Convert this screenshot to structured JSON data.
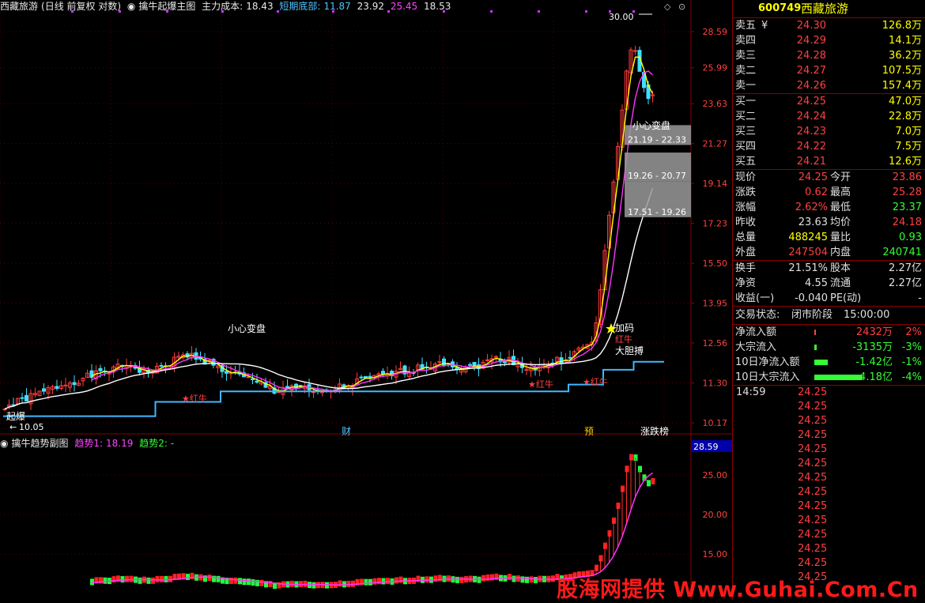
{
  "main_header": {
    "stock_name": "西藏旅游",
    "mode": "(日线 前复权 对数)",
    "indicator": "擒牛起爆主图",
    "cost_label": "主力成本:",
    "cost_value": "18.43",
    "bottom_label": "短期底部:",
    "bottom_value": "11.87",
    "v3": "23.92",
    "v4": "25.45",
    "v5": "18.53"
  },
  "sub_header": {
    "title": "擒牛趋势副图",
    "trend1_label": "趋势1:",
    "trend1_value": "18.19",
    "trend2_label": "趋势2:",
    "trend2_value": "-"
  },
  "main_axis": [
    "28.59",
    "25.99",
    "23.63",
    "21.27",
    "19.14",
    "17.23",
    "15.50",
    "13.95",
    "12.56",
    "11.30",
    "10.17"
  ],
  "sub_axis": [
    "25.00",
    "20.00",
    "15.00"
  ],
  "sub_axis_highlight": "28.59",
  "annotations": {
    "peak": "30.00",
    "low": "10.05",
    "qibao": "起爆",
    "xiaoxin1": "小心变盘",
    "xiaoxin2": "小心变盘",
    "hongniu": "★红牛",
    "jiama": "加码",
    "hongniu2": "红牛",
    "dadan": "大胆搏",
    "cai": "财",
    "yu": "预",
    "zhangdie": "涨跌榜",
    "zone1": "21.19 - 22.33",
    "zone2": "19.26 - 20.77",
    "zone3": "17.51 - 19.26"
  },
  "colors": {
    "up": "#ff3b3b",
    "down": "#40e0ff",
    "ma_yellow": "#ffff00",
    "ma_magenta": "#ff33ff",
    "ma_white": "#ffffff",
    "support": "#40b8ff",
    "grid": "#8b0000"
  },
  "quote": {
    "code": "600749",
    "name": "西藏旅游",
    "asks": [
      {
        "label": "卖五",
        "flag": "¥",
        "price": "24.30",
        "vol": "126.8万"
      },
      {
        "label": "卖四",
        "flag": "",
        "price": "24.29",
        "vol": "14.1万"
      },
      {
        "label": "卖三",
        "flag": "",
        "price": "24.28",
        "vol": "36.2万"
      },
      {
        "label": "卖二",
        "flag": "",
        "price": "24.27",
        "vol": "107.5万"
      },
      {
        "label": "卖一",
        "flag": "",
        "price": "24.26",
        "vol": "157.4万"
      }
    ],
    "bids": [
      {
        "label": "买一",
        "price": "24.25",
        "vol": "47.0万"
      },
      {
        "label": "买二",
        "price": "24.24",
        "vol": "22.8万"
      },
      {
        "label": "买三",
        "price": "24.23",
        "vol": "7.0万"
      },
      {
        "label": "买四",
        "price": "24.22",
        "vol": "7.5万"
      },
      {
        "label": "买五",
        "price": "24.21",
        "vol": "12.6万"
      }
    ],
    "stats1": [
      {
        "l1": "现价",
        "v1": "24.25",
        "c1": "#ff4040",
        "l2": "今开",
        "v2": "23.86",
        "c2": "#ff4040"
      },
      {
        "l1": "涨跌",
        "v1": "0.62",
        "c1": "#ff4040",
        "l2": "最高",
        "v2": "25.28",
        "c2": "#ff4040"
      },
      {
        "l1": "涨幅",
        "v1": "2.62%",
        "c1": "#ff4040",
        "l2": "最低",
        "v2": "23.37",
        "c2": "#33ff33"
      },
      {
        "l1": "昨收",
        "v1": "23.63",
        "c1": "#e0e0e0",
        "l2": "均价",
        "v2": "24.18",
        "c2": "#ff4040"
      },
      {
        "l1": "总量",
        "v1": "488245",
        "c1": "#ffff00",
        "l2": "量比",
        "v2": "0.93",
        "c2": "#33ff33"
      },
      {
        "l1": "外盘",
        "v1": "247504",
        "c1": "#ff4040",
        "l2": "内盘",
        "v2": "240741",
        "c2": "#33ff33"
      }
    ],
    "stats2": [
      {
        "l1": "换手",
        "v1": "21.51%",
        "c1": "#e0e0e0",
        "l2": "股本",
        "v2": "2.27亿",
        "c2": "#e0e0e0"
      },
      {
        "l1": "净资",
        "v1": "4.55",
        "c1": "#e0e0e0",
        "l2": "流通",
        "v2": "2.27亿",
        "c2": "#e0e0e0"
      },
      {
        "l1": "收益(一)",
        "v1": "-0.040",
        "c1": "#e0e0e0",
        "l2": "PE(动)",
        "v2": "-",
        "c2": "#e0e0e0"
      }
    ],
    "status_label": "交易状态:",
    "status_value": "闭市阶段",
    "status_time": "15:00:00",
    "flows": [
      {
        "label": "净流入额",
        "value": "2432万",
        "pct": "2%",
        "color": "#ff4040",
        "bar": 0.02,
        "barColor": "#ff4040"
      },
      {
        "label": "大宗流入",
        "value": "-3135万",
        "pct": "-3%",
        "color": "#33ff33",
        "bar": 0.03,
        "barColor": "#33ff33"
      },
      {
        "label": "10日净流入额",
        "value": "-1.42亿",
        "pct": "-1%",
        "color": "#33ff33",
        "bar": 0.15,
        "barColor": "#33ff33"
      },
      {
        "label": "10日大宗流入",
        "value": "-4.18亿",
        "pct": "-4%",
        "color": "#33ff33",
        "bar": 0.55,
        "barColor": "#33ff33"
      }
    ],
    "ticks": [
      {
        "time": "14:59",
        "price": "24.25"
      },
      {
        "time": "",
        "price": "24.25"
      },
      {
        "time": "",
        "price": "24.25"
      },
      {
        "time": "",
        "price": "24.25"
      },
      {
        "time": "",
        "price": "24.25"
      },
      {
        "time": "",
        "price": "24.25"
      },
      {
        "time": "",
        "price": "24.25"
      },
      {
        "time": "",
        "price": "24.25"
      },
      {
        "time": "",
        "price": "24.25"
      },
      {
        "time": "",
        "price": "24.25"
      },
      {
        "time": "",
        "price": "24.25"
      },
      {
        "time": "",
        "price": "24.25"
      },
      {
        "time": "",
        "price": "24.25"
      },
      {
        "time": "",
        "price": "24.25"
      }
    ]
  },
  "watermark": "股海网提供 Www.Guhai.Com.Cn"
}
